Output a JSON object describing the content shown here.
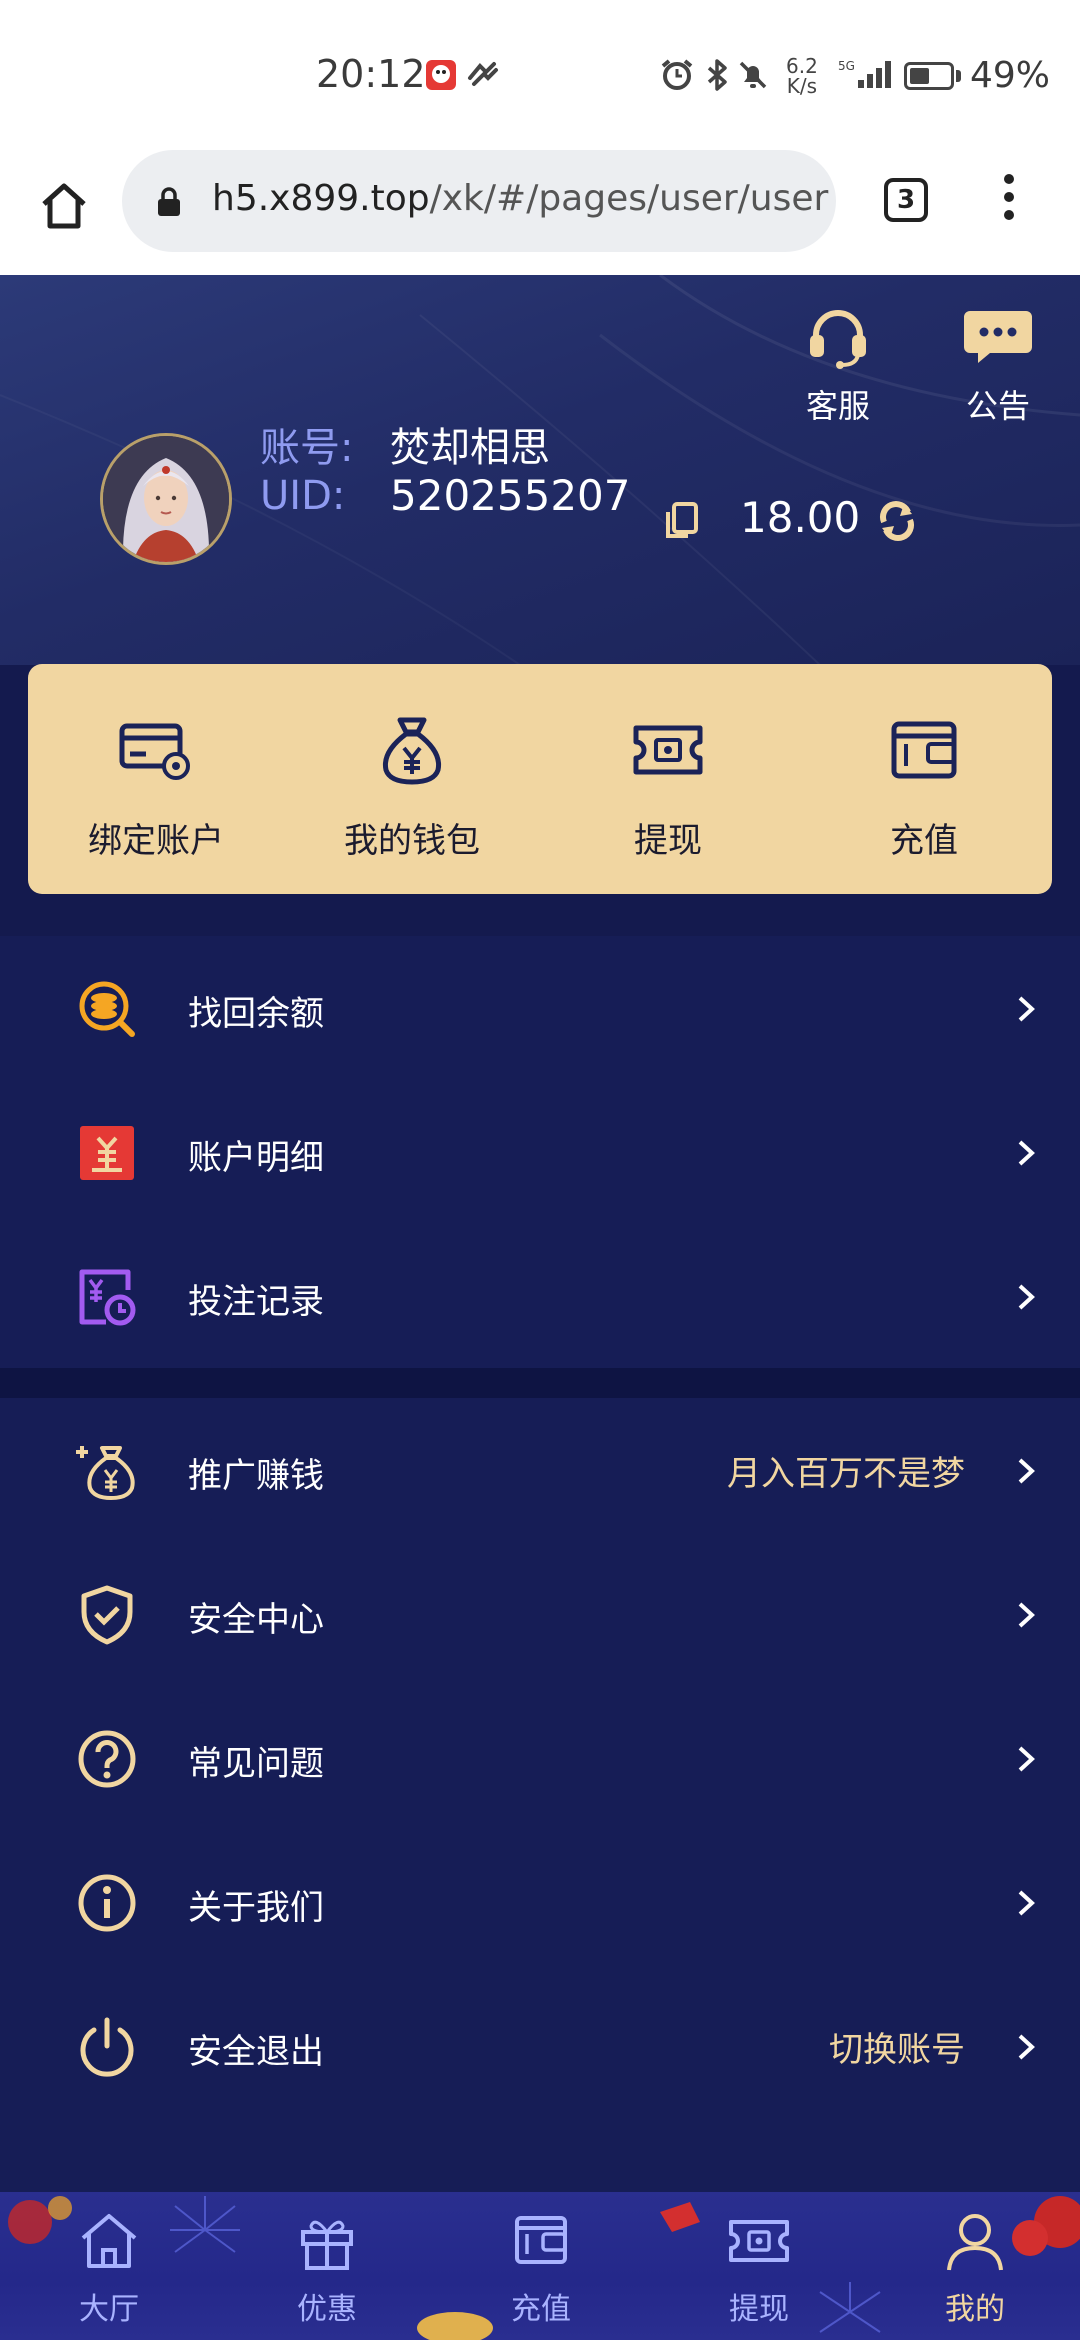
{
  "status_bar": {
    "time": "20:12",
    "net_speed_value": "6.2",
    "net_speed_unit": "K/s",
    "battery_level": 0.49,
    "battery_text": "49%",
    "signal_label": "5G",
    "icons": [
      "app-notification-icon",
      "app-notification-icon",
      "alarm-icon",
      "bluetooth-icon",
      "mute-icon",
      "signal-icon",
      "battery-icon"
    ]
  },
  "browser": {
    "url_host": "h5.x899.top",
    "url_path": "/xk/#/pages/user/user",
    "tab_count": "3"
  },
  "header": {
    "customer_service_label": "客服",
    "announcement_label": "公告",
    "account_label": "账号:",
    "account_name": "焚却相思",
    "uid_label": "UID:",
    "uid_value": "520255207",
    "balance": "18.00"
  },
  "quick_actions": [
    {
      "label": "绑定账户",
      "icon": "bind-card-icon"
    },
    {
      "label": "我的钱包",
      "icon": "money-bag-icon"
    },
    {
      "label": "提现",
      "icon": "withdraw-icon"
    },
    {
      "label": "充值",
      "icon": "wallet-icon"
    }
  ],
  "menu_group_1": [
    {
      "label": "找回余额",
      "icon": "coin-search-icon",
      "extra": ""
    },
    {
      "label": "账户明细",
      "icon": "ledger-icon",
      "extra": ""
    },
    {
      "label": "投注记录",
      "icon": "bet-record-icon",
      "extra": ""
    }
  ],
  "menu_group_2": [
    {
      "label": "推广赚钱",
      "icon": "promo-money-icon",
      "extra": "月入百万不是梦"
    },
    {
      "label": "安全中心",
      "icon": "shield-icon",
      "extra": ""
    },
    {
      "label": "常见问题",
      "icon": "question-icon",
      "extra": ""
    },
    {
      "label": "关于我们",
      "icon": "info-icon",
      "extra": ""
    },
    {
      "label": "安全退出",
      "icon": "power-icon",
      "extra": "切换账号"
    }
  ],
  "bottom_nav": [
    {
      "label": "大厅",
      "icon": "home-icon",
      "active": false
    },
    {
      "label": "优惠",
      "icon": "gift-icon",
      "active": false
    },
    {
      "label": "充值",
      "icon": "wallet-icon",
      "active": false
    },
    {
      "label": "提现",
      "icon": "withdraw-icon",
      "active": false
    },
    {
      "label": "我的",
      "icon": "user-icon",
      "active": true
    }
  ],
  "colors": {
    "page_bg": "#141a4e",
    "header_bg": "#222c66",
    "gold": "#f1d6a1",
    "accent_blue": "#8f9bf0",
    "nav_bg": "#2a2f8f"
  }
}
